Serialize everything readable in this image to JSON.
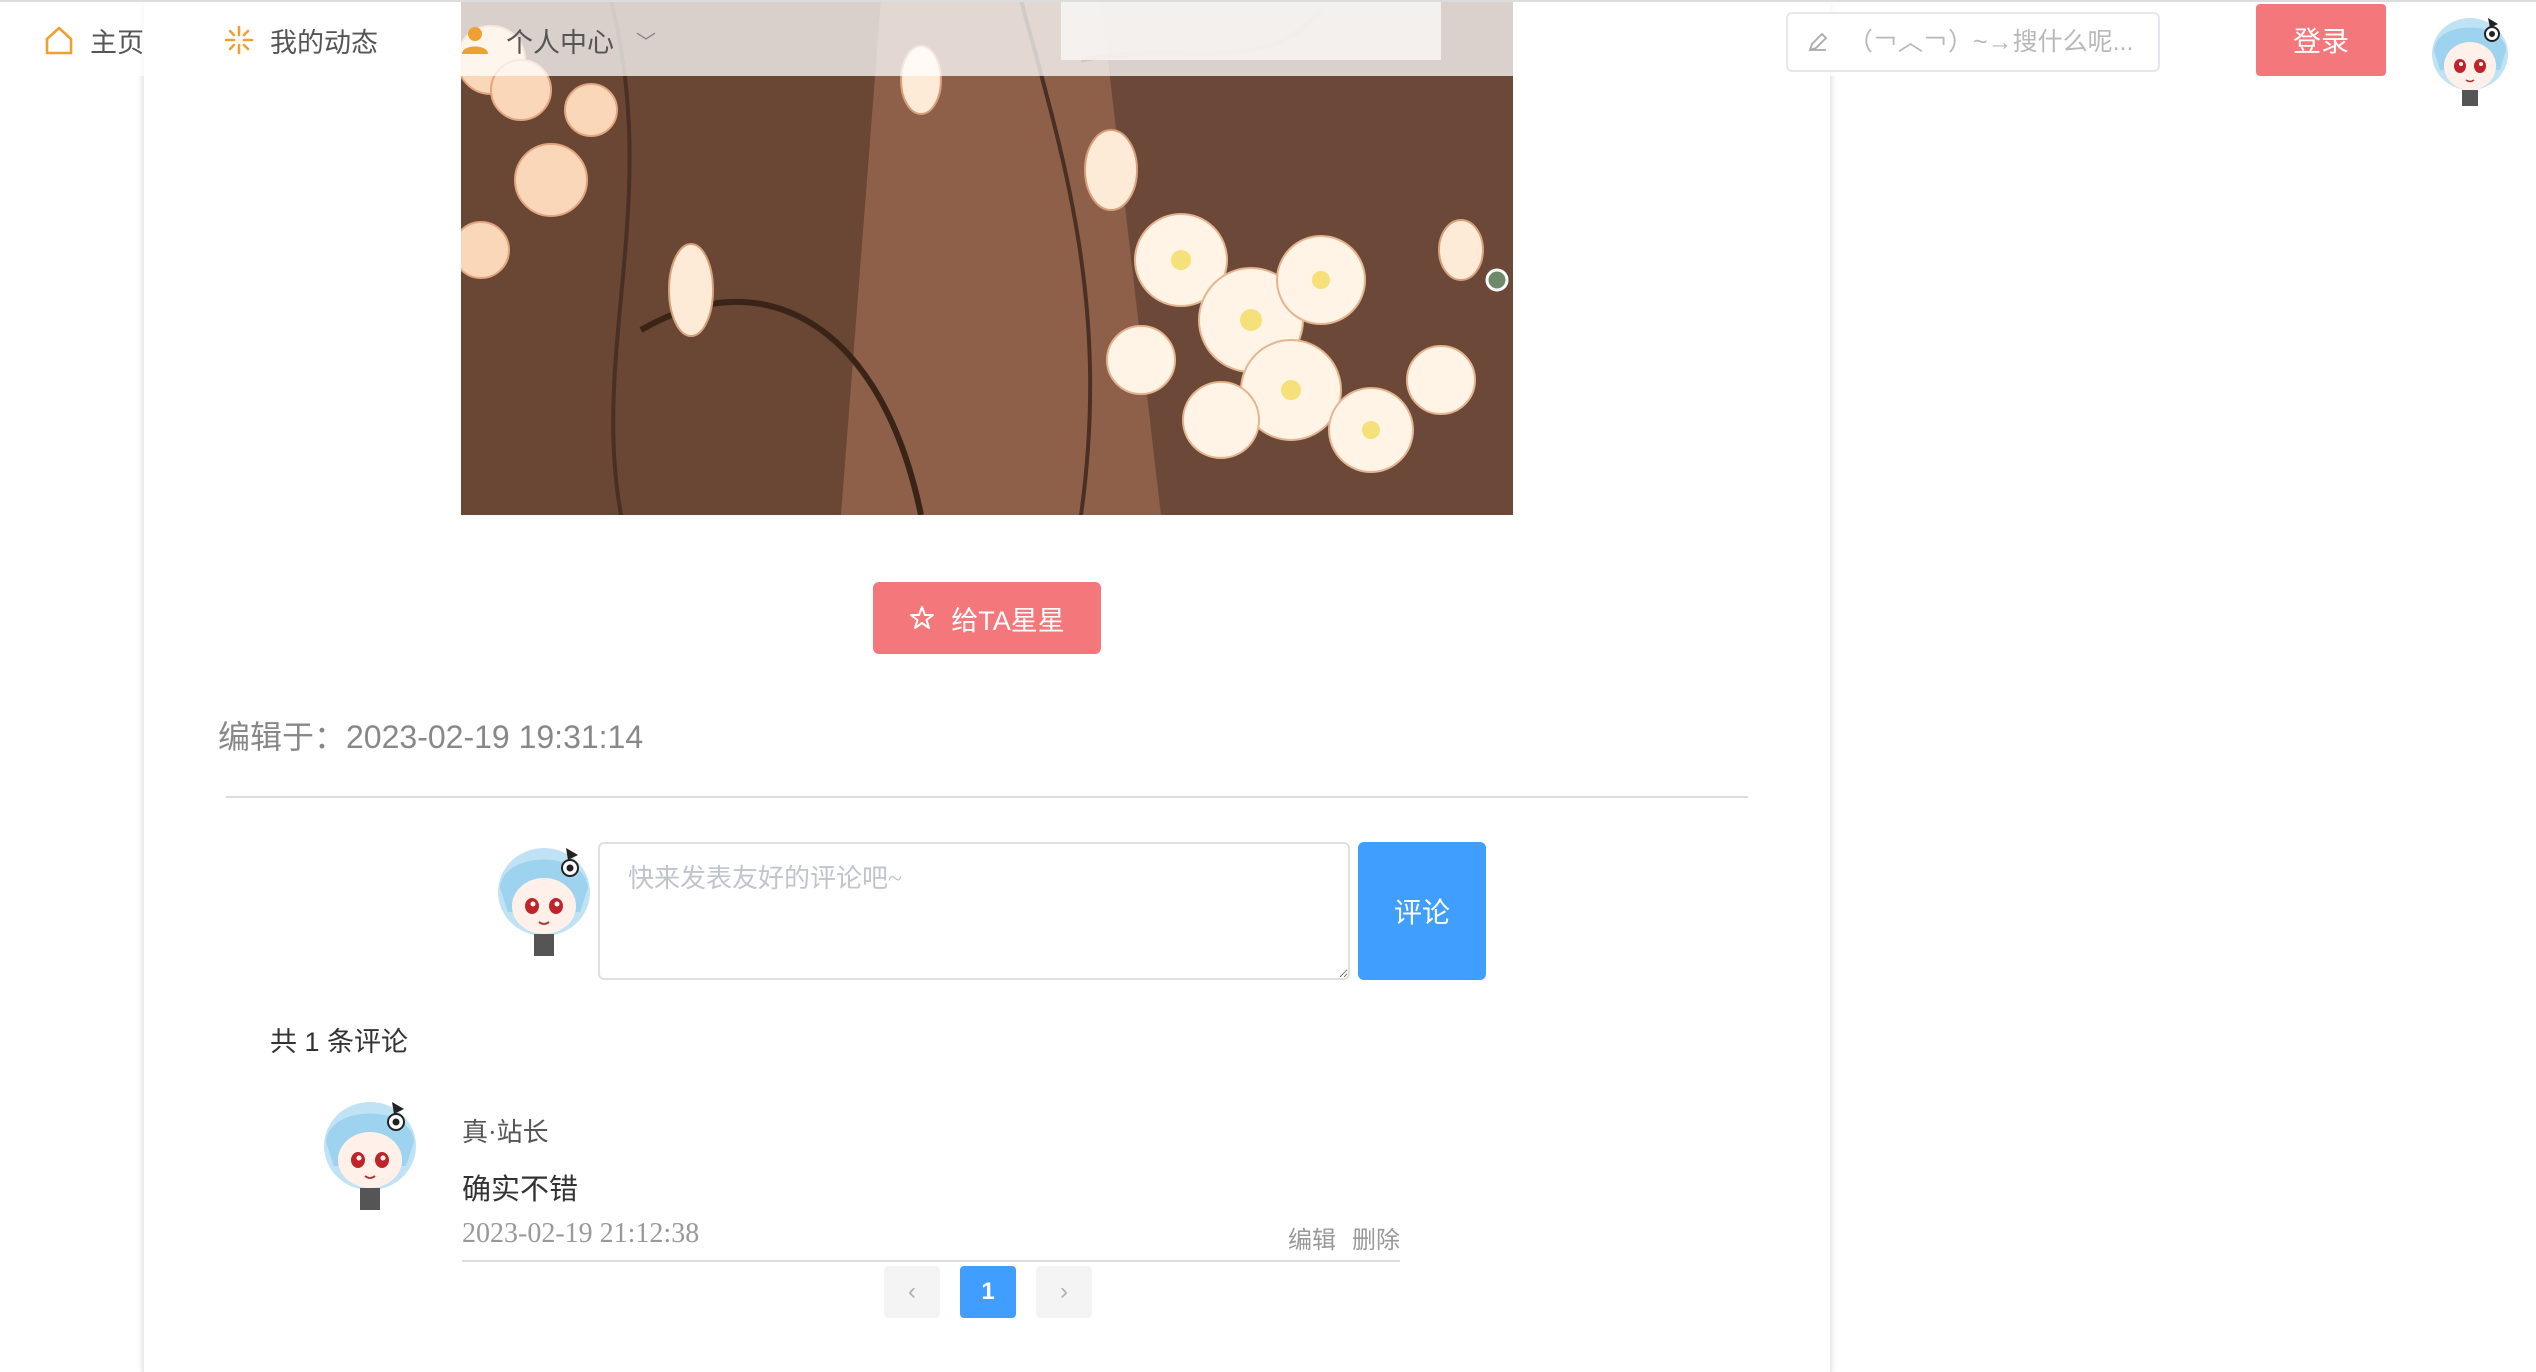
{
  "nav": {
    "home_label": "主页",
    "dynamic_label": "我的动态",
    "center_label": "个人中心",
    "search_placeholder": "（￢︿￢）~→搜什么呢...",
    "login_label": "登录"
  },
  "article": {
    "star_button_label": "给TA星星",
    "edited_text": "编辑于：2023-02-19 19:31:14"
  },
  "comment_form": {
    "placeholder": "快来发表友好的评论吧~",
    "submit_label": "评论"
  },
  "comments": {
    "count_text": "共 1 条评论",
    "items": [
      {
        "author": "真·站长",
        "text": "确实不错",
        "date": "2023-02-19 21:12:38",
        "edit_label": "编辑",
        "delete_label": "删除"
      }
    ]
  },
  "pagination": {
    "prev": "‹",
    "current": "1",
    "next": "›"
  },
  "colors": {
    "accent_pink": "#f4787b",
    "accent_blue": "#409eff",
    "nav_icon_orange": "#f0a030"
  }
}
